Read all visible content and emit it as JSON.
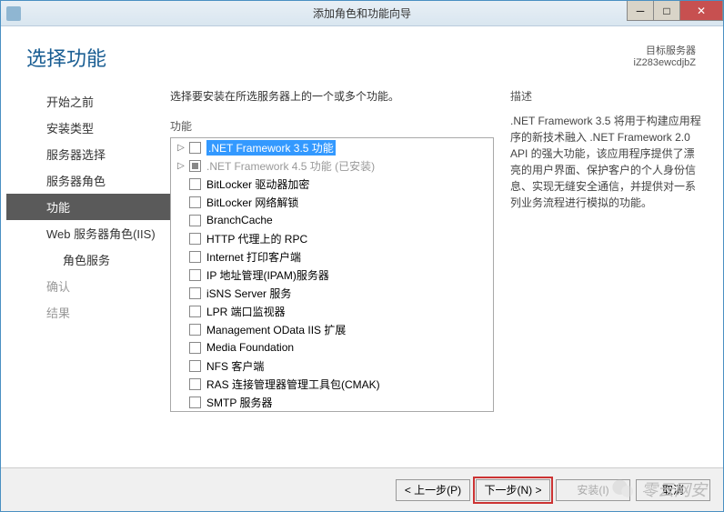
{
  "window": {
    "title": "添加角色和功能向导"
  },
  "header": {
    "page_title": "选择功能",
    "dest_label": "目标服务器",
    "dest_value": "iZ283ewcdjbZ"
  },
  "nav": [
    {
      "label": "开始之前",
      "state": "past"
    },
    {
      "label": "安装类型",
      "state": "past"
    },
    {
      "label": "服务器选择",
      "state": "past"
    },
    {
      "label": "服务器角色",
      "state": "past"
    },
    {
      "label": "功能",
      "state": "active"
    },
    {
      "label": "Web 服务器角色(IIS)",
      "state": "past"
    },
    {
      "label": "角色服务",
      "state": "past",
      "indent": true
    },
    {
      "label": "确认",
      "state": "future"
    },
    {
      "label": "结果",
      "state": "future"
    }
  ],
  "main": {
    "instruction": "选择要安装在所选服务器上的一个或多个功能。",
    "list_label": "功能",
    "features": [
      {
        "label": ".NET Framework 3.5 功能",
        "expandable": true,
        "selected": true,
        "checked": false
      },
      {
        "label": ".NET Framework 4.5 功能 (已安装)",
        "expandable": true,
        "disabled": true,
        "checked": "filled"
      },
      {
        "label": "BitLocker 驱动器加密"
      },
      {
        "label": "BitLocker 网络解锁"
      },
      {
        "label": "BranchCache"
      },
      {
        "label": "HTTP 代理上的 RPC"
      },
      {
        "label": "Internet 打印客户端"
      },
      {
        "label": "IP 地址管理(IPAM)服务器"
      },
      {
        "label": "iSNS Server 服务"
      },
      {
        "label": "LPR 端口监视器"
      },
      {
        "label": "Management OData IIS 扩展"
      },
      {
        "label": "Media Foundation"
      },
      {
        "label": "NFS 客户端"
      },
      {
        "label": "RAS 连接管理器管理工具包(CMAK)"
      },
      {
        "label": "SMTP 服务器"
      }
    ]
  },
  "description": {
    "label": "描述",
    "text": ".NET Framework 3.5 将用于构建应用程序的新技术融入 .NET Framework 2.0 API 的强大功能，该应用程序提供了漂亮的用户界面、保护客户的个人身份信息、实现无缝安全通信，并提供对一系列业务流程进行模拟的功能。"
  },
  "footer": {
    "prev": "< 上一步(P)",
    "next": "下一步(N) >",
    "install": "安装(I)",
    "cancel": "取消"
  },
  "watermark": "零云网安"
}
